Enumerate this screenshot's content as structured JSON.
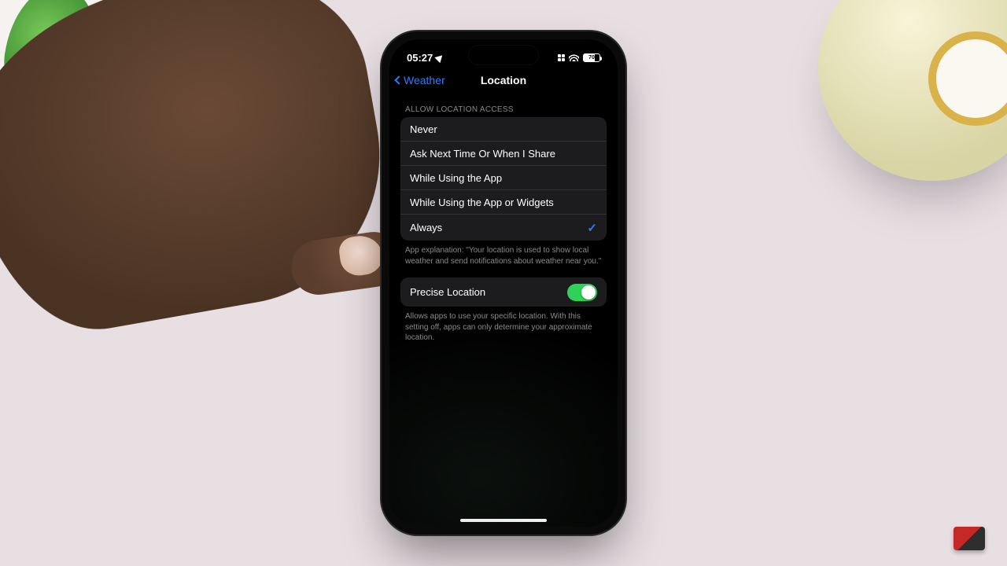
{
  "status_bar": {
    "time": "05:27",
    "battery_text": "70"
  },
  "nav": {
    "back_label": "Weather",
    "title": "Location"
  },
  "section_header": "ALLOW LOCATION ACCESS",
  "options": [
    {
      "label": "Never",
      "selected": false
    },
    {
      "label": "Ask Next Time Or When I Share",
      "selected": false
    },
    {
      "label": "While Using the App",
      "selected": false
    },
    {
      "label": "While Using the App or Widgets",
      "selected": false
    },
    {
      "label": "Always",
      "selected": true
    }
  ],
  "explanation": "App explanation: \"Your location is used to show local weather and send notifications about weather near you.\"",
  "precise": {
    "label": "Precise Location",
    "enabled": true,
    "footer": "Allows apps to use your specific location. With this setting off, apps can only determine your approximate location."
  }
}
